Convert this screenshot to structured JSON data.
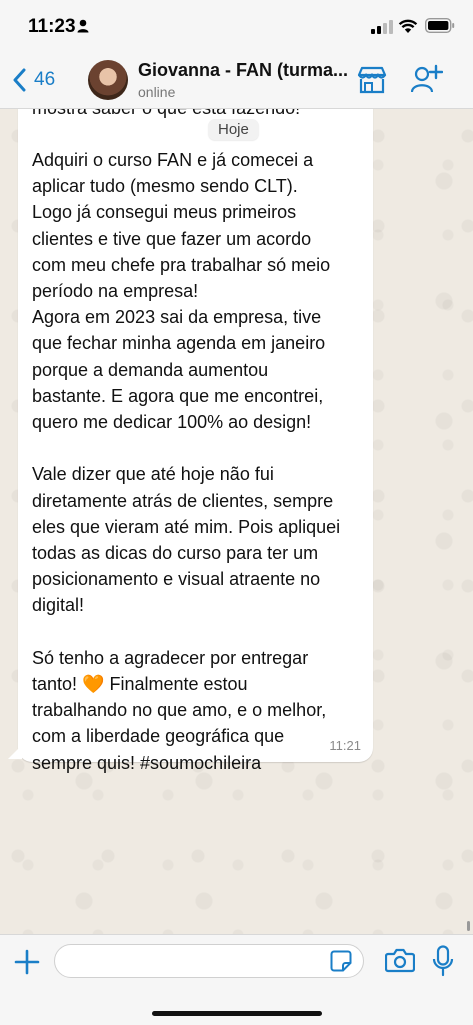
{
  "status_bar": {
    "time": "11:23"
  },
  "header": {
    "back_count": "46",
    "title": "Giovanna - FAN (turma...",
    "subtitle": "online"
  },
  "chat": {
    "top_partial_line": "mostra saber o que está fazendo!",
    "date_label": "Hoje",
    "message": "Adquiri o curso FAN e já comecei a\naplicar tudo (mesmo sendo CLT).\nLogo já consegui meus primeiros\nclientes e tive que fazer um acordo\ncom meu chefe pra trabalhar só meio\nperíodo na empresa!\nAgora em 2023 sai da empresa, tive\nque fechar minha agenda em janeiro\nporque a demanda aumentou\nbastante. E agora que me encontrei,\nquero me dedicar 100% ao design!\n\nVale dizer que até hoje não fui\ndiretamente atrás de clientes, sempre\neles que vieram até mim. Pois apliquei\ntodas as dicas do curso para ter um\nposicionamento e visual atraente no\ndigital!\n\nSó tenho a agradecer por entregar\ntanto! 🧡 Finalmente estou\ntrabalhando no que amo, e o melhor,\ncom a liberdade geográfica que\nsempre quis! #soumochileira",
    "time": "11:21"
  },
  "input": {
    "value": "",
    "placeholder": ""
  },
  "colors": {
    "accent": "#1a7ec7",
    "bubble": "#ffffff",
    "background": "#efeae2"
  }
}
